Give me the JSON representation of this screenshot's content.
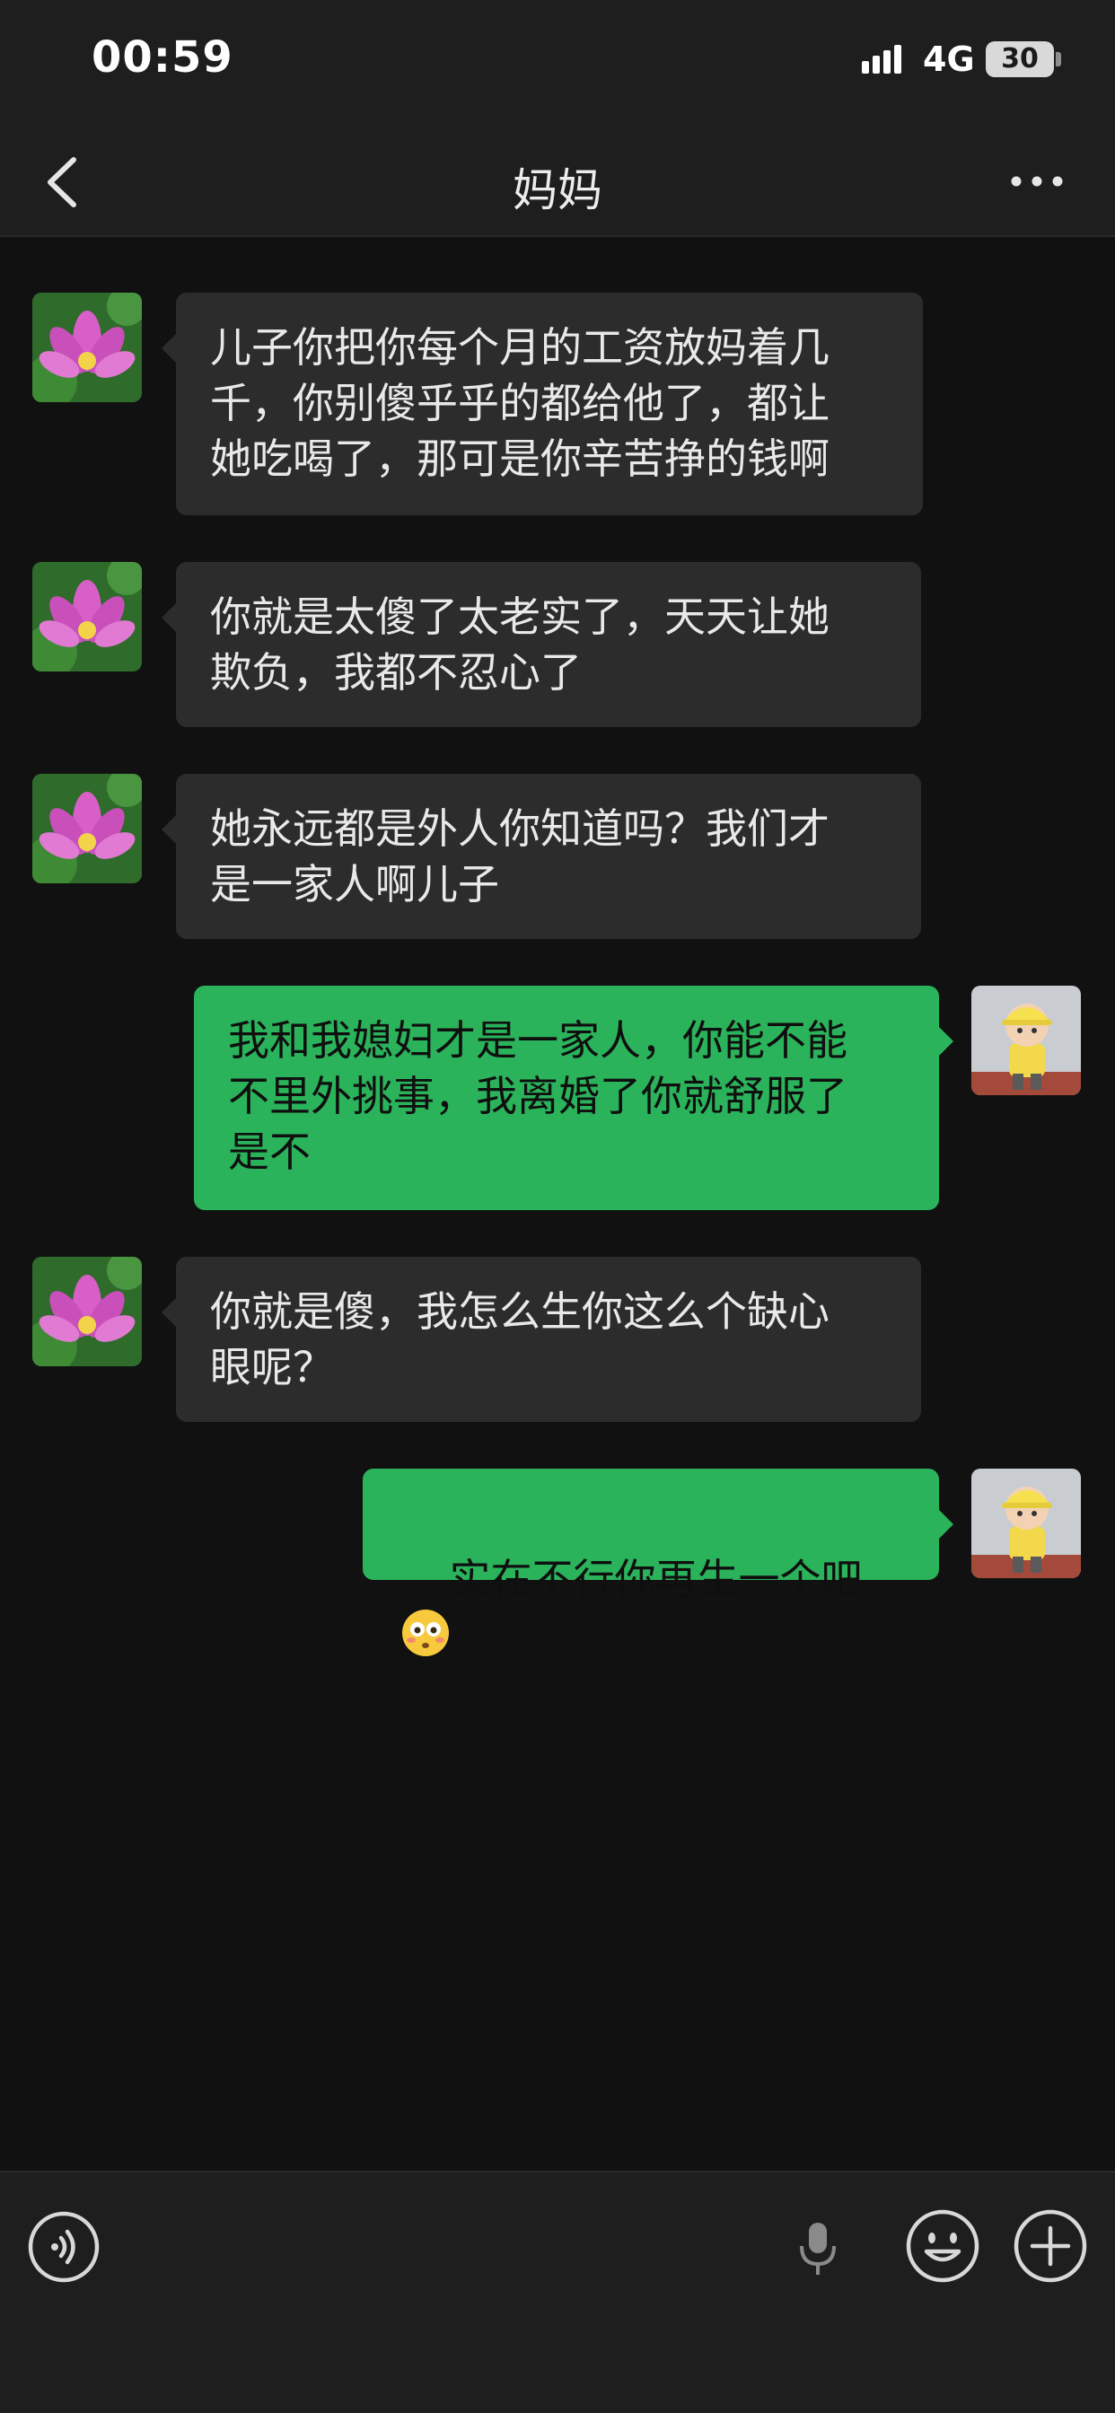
{
  "status": {
    "time": "00:59",
    "network": "4G",
    "battery": "30"
  },
  "header": {
    "title": "妈妈"
  },
  "messages": [
    {
      "from": "mom",
      "text": "儿子你把你每个月的工资放妈着几\n千，你别傻乎乎的都给他了，都让\n她吃喝了，那可是你辛苦挣的钱啊"
    },
    {
      "from": "mom",
      "text": "你就是太傻了太老实了，天天让她\n欺负，我都不忍心了"
    },
    {
      "from": "mom",
      "text": "她永远都是外人你知道吗？我们才\n是一家人啊儿子"
    },
    {
      "from": "me",
      "text": "我和我媳妇才是一家人，你能不能\n不里外挑事，我离婚了你就舒服了\n是不"
    },
    {
      "from": "mom",
      "text": "你就是傻，我怎么生你这么个缺心\n眼呢？"
    },
    {
      "from": "me",
      "text": "实在不行你再生一个吧",
      "emoji": "flushed-face"
    }
  ],
  "colors": {
    "incoming_bubble": "#2c2c2c",
    "outgoing_bubble": "#2bb35b",
    "background": "#111111"
  }
}
